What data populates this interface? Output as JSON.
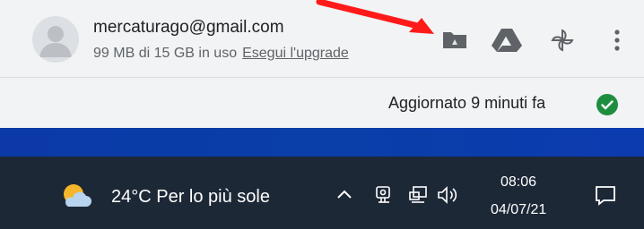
{
  "account": {
    "email": "mercaturago@gmail.com",
    "usage_text": "99 MB di 15 GB in uso",
    "upgrade_label": "Esegui l'upgrade"
  },
  "toolbar": {
    "icons": [
      "drive-folder-icon",
      "google-drive-icon",
      "google-photos-icon",
      "more-vert-icon"
    ]
  },
  "status": {
    "text": "Aggiornato 9 minuti fa",
    "color": "#1e8e3e"
  },
  "taskbar": {
    "weather": "24°C  Per lo più sole",
    "time": "08:06",
    "date": "04/07/21",
    "tray_icons": [
      "chevron-up-icon",
      "meet-now-icon",
      "network-icon",
      "volume-icon"
    ]
  },
  "annotation": {
    "arrow_color": "#ff1a1a"
  }
}
